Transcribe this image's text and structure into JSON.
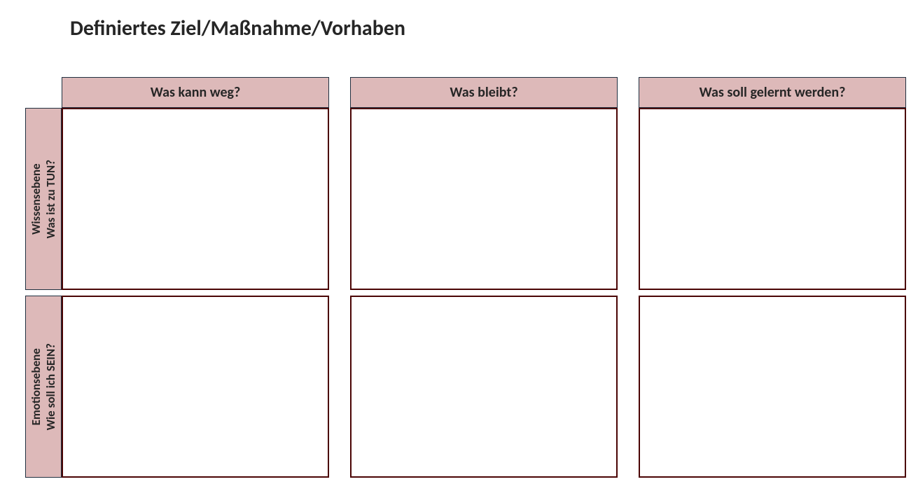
{
  "title": "Definiertes Ziel/Maßnahme/Vorhaben",
  "columns": [
    {
      "label": "Was kann weg?"
    },
    {
      "label": "Was bleibt?"
    },
    {
      "label": "Was soll gelernt werden?"
    }
  ],
  "rows": [
    {
      "levelLabel": "Wissensebene",
      "questionLabel": "Was ist zu TUN?",
      "cells": [
        "",
        "",
        ""
      ]
    },
    {
      "levelLabel": "Emotionsebene",
      "questionLabel": "Wie soll ich SEIN?",
      "cells": [
        "",
        "",
        ""
      ]
    }
  ],
  "colors": {
    "headerFill": "#ddb9b9",
    "headerBorder": "#203040",
    "cellBorder": "#4a0404",
    "text": "#262626"
  }
}
